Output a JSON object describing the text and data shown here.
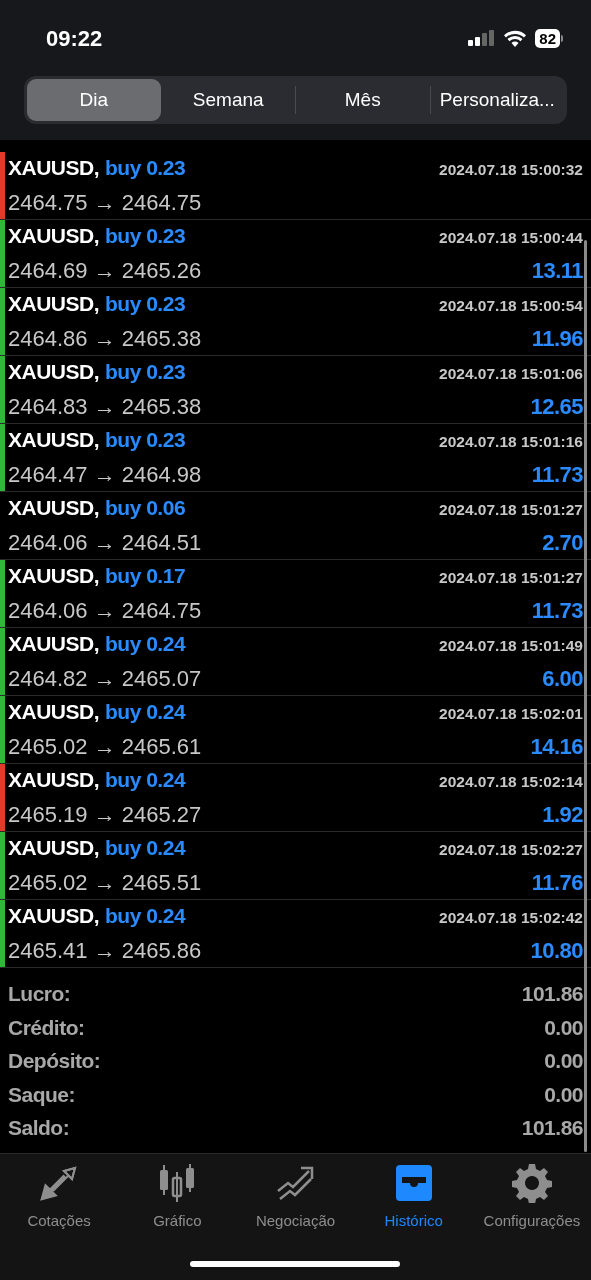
{
  "status_bar": {
    "time": "09:22",
    "battery": "82"
  },
  "period_tabs": [
    {
      "label": "Dia",
      "selected": true
    },
    {
      "label": "Semana",
      "selected": false
    },
    {
      "label": "Mês",
      "selected": false
    },
    {
      "label": "Personaliza...",
      "selected": false
    }
  ],
  "deals": [
    {
      "symbol": "XAUUSD,",
      "side": "buy 0.23",
      "time": "2024.07.18 15:00:32",
      "prices": "2464.75 → 2464.75",
      "color": "#e0392f"
    },
    {
      "symbol": "XAUUSD,",
      "side": "buy 0.23",
      "time": "2024.07.18 15:00:44",
      "prices": "2464.69 → 2465.26",
      "profit": "13.11",
      "color": "#2fb83a"
    },
    {
      "symbol": "XAUUSD,",
      "side": "buy 0.23",
      "time": "2024.07.18 15:00:54",
      "prices": "2464.86 → 2465.38",
      "profit": "11.96",
      "color": "#2fb83a"
    },
    {
      "symbol": "XAUUSD,",
      "side": "buy 0.23",
      "time": "2024.07.18 15:01:06",
      "prices": "2464.83 → 2465.38",
      "profit": "12.65",
      "color": "#2fb83a"
    },
    {
      "symbol": "XAUUSD,",
      "side": "buy 0.23",
      "time": "2024.07.18 15:01:16",
      "prices": "2464.47 → 2464.98",
      "profit": "11.73",
      "color": "#2fb83a"
    },
    {
      "symbol": "XAUUSD,",
      "side": "buy 0.06",
      "time": "2024.07.18 15:01:27",
      "prices": "2464.06 → 2464.51",
      "profit": "2.70"
    },
    {
      "symbol": "XAUUSD,",
      "side": "buy 0.17",
      "time": "2024.07.18 15:01:27",
      "prices": "2464.06 → 2464.75",
      "profit": "11.73",
      "color": "#2fb83a"
    },
    {
      "symbol": "XAUUSD,",
      "side": "buy 0.24",
      "time": "2024.07.18 15:01:49",
      "prices": "2464.82 → 2465.07",
      "profit": "6.00",
      "color": "#2fb83a"
    },
    {
      "symbol": "XAUUSD,",
      "side": "buy 0.24",
      "time": "2024.07.18 15:02:01",
      "prices": "2465.02 → 2465.61",
      "profit": "14.16",
      "color": "#2fb83a"
    },
    {
      "symbol": "XAUUSD,",
      "side": "buy 0.24",
      "time": "2024.07.18 15:02:14",
      "prices": "2465.19 → 2465.27",
      "profit": "1.92",
      "color": "#e0392f"
    },
    {
      "symbol": "XAUUSD,",
      "side": "buy 0.24",
      "time": "2024.07.18 15:02:27",
      "prices": "2465.02 → 2465.51",
      "profit": "11.76",
      "color": "#2fb83a"
    },
    {
      "symbol": "XAUUSD,",
      "side": "buy 0.24",
      "time": "2024.07.18 15:02:42",
      "prices": "2465.41 → 2465.86",
      "profit": "10.80",
      "color": "#2fb83a"
    }
  ],
  "summary": [
    {
      "label": "Lucro:",
      "value": "101.86"
    },
    {
      "label": "Crédito:",
      "value": "0.00"
    },
    {
      "label": "Depósito:",
      "value": "0.00"
    },
    {
      "label": "Saque:",
      "value": "0.00"
    },
    {
      "label": "Saldo:",
      "value": "101.86"
    }
  ],
  "tab_bar": [
    {
      "kind": "quotes",
      "label": "Cotações",
      "selected": false
    },
    {
      "kind": "chart",
      "label": "Gráfico",
      "selected": false
    },
    {
      "kind": "trade",
      "label": "Negociação",
      "selected": false
    },
    {
      "kind": "history",
      "label": "Histórico",
      "selected": true
    },
    {
      "kind": "settings",
      "label": "Configurações",
      "selected": false
    }
  ]
}
